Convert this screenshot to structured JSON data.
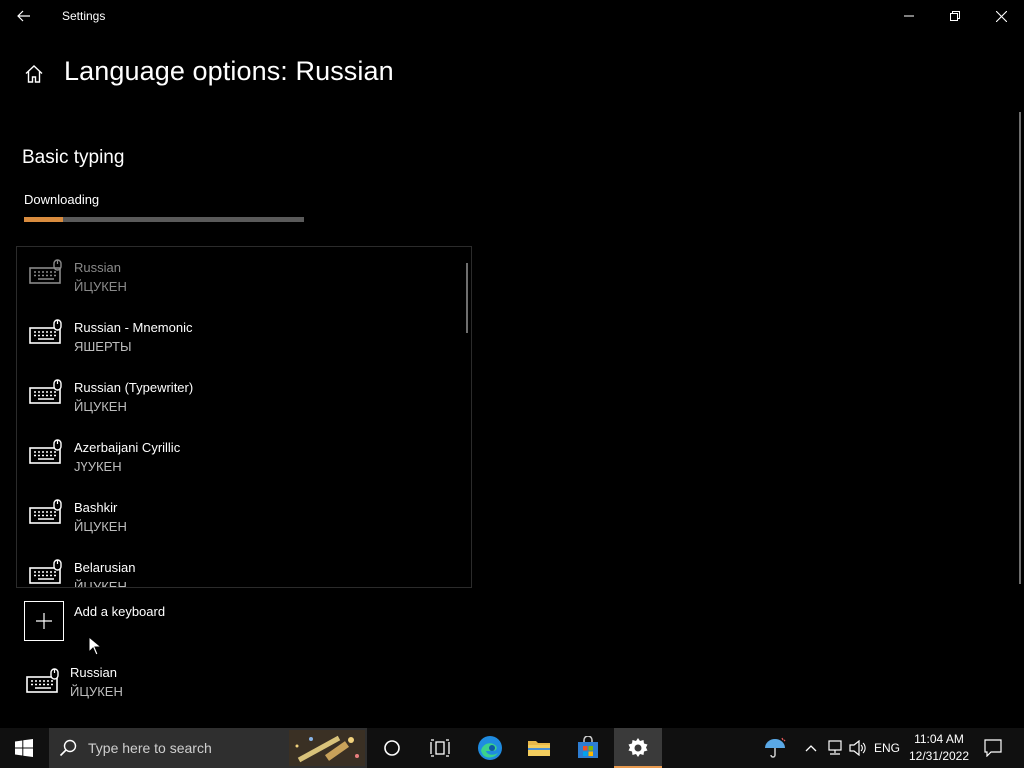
{
  "window": {
    "title": "Settings"
  },
  "header": {
    "title": "Language options: Russian"
  },
  "section": {
    "title": "Basic typing",
    "status": "Downloading",
    "progress_fraction": 0.14
  },
  "keyboard_list": [
    {
      "name": "Russian",
      "layout": "ЙЦУКЕН"
    },
    {
      "name": "Russian - Mnemonic",
      "layout": "ЯШЕРТЫ"
    },
    {
      "name": "Russian (Typewriter)",
      "layout": "ЙЦУКЕН"
    },
    {
      "name": "Azerbaijani Cyrillic",
      "layout": "ЈҮУКЕН"
    },
    {
      "name": "Bashkir",
      "layout": "ЙЦУКЕН"
    },
    {
      "name": "Belarusian",
      "layout": "ЙЦУКЕН"
    }
  ],
  "add_keyboard": {
    "label": "Add a keyboard"
  },
  "installed_keyboard": {
    "name": "Russian",
    "layout": "ЙЦУКЕН"
  },
  "taskbar": {
    "search_placeholder": "Type here to search",
    "language": "ENG",
    "time": "11:04 AM",
    "date": "12/31/2022"
  },
  "colors": {
    "accent": "#d98c3f",
    "background": "#000000",
    "taskbar": "#101010"
  }
}
